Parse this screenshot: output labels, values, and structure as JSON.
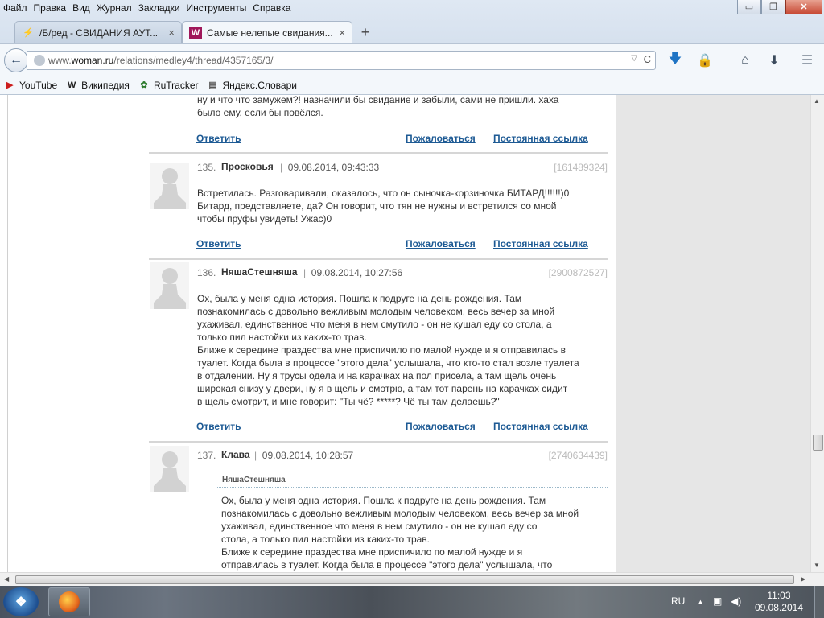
{
  "menubar": [
    "Файл",
    "Правка",
    "Вид",
    "Журнал",
    "Закладки",
    "Инструменты",
    "Справка"
  ],
  "window_controls": {
    "minimize": "▭",
    "maximize": "❐",
    "close": "✕"
  },
  "tabs": [
    {
      "title": "/Б/ред - СВИДАНИЯ АУТ...",
      "favicon": "⚡",
      "favicon_color": "#e8a018",
      "close": "×"
    },
    {
      "title": "Самые нелепые свидания...",
      "favicon": "W",
      "favicon_color": "#a0185a",
      "close": "×"
    }
  ],
  "new_tab": "+",
  "urlbar": {
    "prefix": "www.",
    "host": "woman.ru",
    "path": "/relations/medley4/thread/4357165/3/",
    "dropdown": "▽",
    "reload": "C"
  },
  "bookmarks": [
    {
      "label": "YouTube",
      "icon": "▶",
      "icon_color": "#cc1d1d"
    },
    {
      "label": "Википедия",
      "icon": "W",
      "icon_color": "#222"
    },
    {
      "label": "RuTracker",
      "icon": "✿",
      "icon_color": "#2b7a2b"
    },
    {
      "label": "Яндекс.Словари",
      "icon": "▤",
      "icon_color": "#555"
    }
  ],
  "actions": {
    "reply": "Ответить",
    "report": "Пожаловаться",
    "permalink": "Постоянная ссылка"
  },
  "posts": [
    {
      "text_lines": [
        "ну и что что замужем?! назначили бы свидание и забыли, сами не пришли. хаха",
        "было ему, если бы повёлся."
      ]
    },
    {
      "num": "135.",
      "author": "Просковья",
      "sep": "|",
      "date": "09.08.2014, 09:43:33",
      "id": "[161489324]",
      "text_lines": [
        "Встретилась. Разговаривали, оказалось, что он сыночка-корзиночка БИТАРД!!!!!!)0",
        "Битард, представляете, да? Он говорит, что тян не нужны и встретился со мной",
        "чтобы пруфы увидеть! Ужас)0"
      ]
    },
    {
      "num": "136.",
      "author": "НяшаСтешняша",
      "sep": "|",
      "date": "09.08.2014, 10:27:56",
      "id": "[2900872527]",
      "text_lines": [
        "Ох, была у меня одна история. Пошла к подруге на день рождения. Там",
        "познакомилась с довольно вежливым молодым человеком, весь вечер за мной",
        "ухаживал, единственное что меня в нем смутило - он не кушал еду со стола, а",
        "только пил настойки из каких-то трав.",
        "Ближе к середине праздества мне приспичило по малой нужде и я отправилась в",
        "туалет. Когда была в процессе \"этого дела\" услышала, что кто-то стал возле туалета",
        "в отдалении. Ну я трусы одела и на карачках на пол присела, а там щель очень",
        "широкая снизу у двери, ну я в щель и смотрю, а там тот парень на карачках сидит",
        "в щель смотрит, и мне говорит: \"Ты чё? *****? Чё ты там делаешь?\""
      ]
    },
    {
      "num": "137.",
      "author": "Клава",
      "sep": "|",
      "date": "09.08.2014, 10:28:57",
      "id": "[2740634439]",
      "quote_author": "НяшаСтешняша",
      "text_lines": [
        "Ох, была у меня одна история. Пошла к подруге на день рождения. Там",
        "познакомилась с довольно вежливым молодым человеком, весь вечер за мной",
        "ухаживал, единственное что меня в нем смутило - он не кушал еду со",
        "стола, а только пил настойки из каких-то трав.",
        "Ближе к середине праздества мне приспичило по малой нужде и я",
        "отправилась в туалет. Когда была в процессе \"этого дела\" услышала, что"
      ]
    }
  ],
  "taskbar": {
    "lang": "RU",
    "tray_icons": [
      "▲",
      "▣",
      "◀)"
    ],
    "time": "11:03",
    "date": "09.08.2014"
  }
}
